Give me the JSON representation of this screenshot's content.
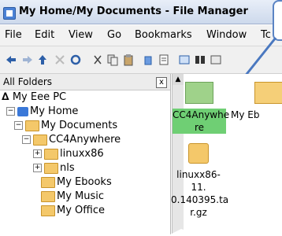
{
  "window": {
    "title": "My Home/My Documents - File Manager"
  },
  "menubar": [
    "File",
    "Edit",
    "View",
    "Go",
    "Bookmarks",
    "Window",
    "Tc"
  ],
  "sidebar": {
    "title": "All Folders",
    "close": "x",
    "tree": [
      {
        "label": "My Eee PC"
      },
      {
        "label": "My Home"
      },
      {
        "label": "My Documents"
      },
      {
        "label": "CC4Anywhere"
      },
      {
        "label": "linuxx86"
      },
      {
        "label": "nls"
      },
      {
        "label": "My Ebooks"
      },
      {
        "label": "My Music"
      },
      {
        "label": "My Office"
      }
    ]
  },
  "content": {
    "items": [
      {
        "label": "CC4Anywhe re"
      },
      {
        "label": "My Eb"
      },
      {
        "label": "linuxx86-11. 0.140395.ta r.gz"
      }
    ]
  },
  "colors": {
    "selection": "#6fcf74",
    "accent": "#3a78d8"
  }
}
